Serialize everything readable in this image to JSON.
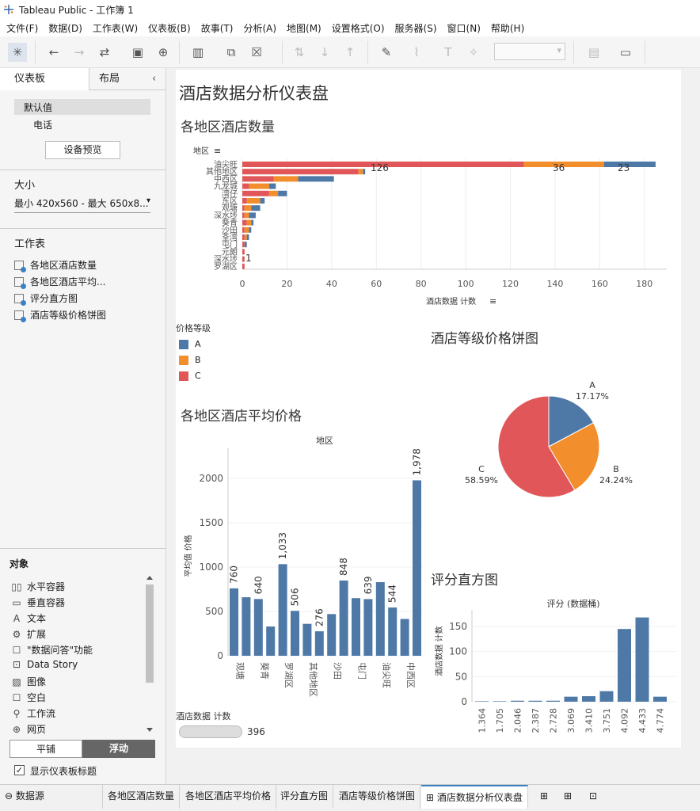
{
  "window": {
    "title": "Tableau Public - 工作簿 1"
  },
  "menu": [
    "文件(F)",
    "数据(D)",
    "工作表(W)",
    "仪表板(B)",
    "故事(T)",
    "分析(A)",
    "地图(M)",
    "设置格式(O)",
    "服务器(S)",
    "窗口(N)",
    "帮助(H)"
  ],
  "toolbar": {
    "icons": [
      "tableau-logo-icon",
      "undo-icon",
      "redo-icon",
      "replay-icon",
      "save-icon",
      "new-datasource-icon",
      "new-worksheet-icon",
      "duplicate-icon",
      "clear-icon",
      "swap-icon",
      "sort-asc-icon",
      "sort-desc-icon",
      "highlight-icon",
      "annotate-icon",
      "labels-icon",
      "pin-icon",
      "show-me-icon",
      "presentation-icon"
    ]
  },
  "left_pane": {
    "tabs": [
      "仪表板",
      "布局"
    ],
    "device_default": "默认值",
    "device_phone": "电话",
    "device_preview_button": "设备预览",
    "size_title": "大小",
    "size_value": "最小 420x560 - 最大 650x8...",
    "worksheets_title": "工作表",
    "worksheets": [
      "各地区酒店数量",
      "各地区酒店平均...",
      "评分直方图",
      "酒店等级价格饼图"
    ],
    "objects_title": "对象",
    "objects": [
      {
        "icon": "horizontal-container-icon",
        "label": "水平容器"
      },
      {
        "icon": "vertical-container-icon",
        "label": "垂直容器"
      },
      {
        "icon": "text-icon",
        "label": "文本"
      },
      {
        "icon": "extension-icon",
        "label": "扩展"
      },
      {
        "icon": "ask-data-icon",
        "label": "\"数据问答\"功能"
      },
      {
        "icon": "data-story-icon",
        "label": "Data Story"
      },
      {
        "icon": "image-icon",
        "label": "图像"
      },
      {
        "icon": "blank-icon",
        "label": "空白"
      },
      {
        "icon": "workflow-icon",
        "label": "工作流"
      },
      {
        "icon": "web-icon",
        "label": "网页"
      }
    ],
    "toggle_tiled": "平铺",
    "toggle_floating": "浮动",
    "show_title_label": "显示仪表板标题",
    "show_title_checked": true
  },
  "dashboard": {
    "title": "酒店数据分析仪表盘",
    "colors": {
      "A": "#4e79a7",
      "B": "#f28e2b",
      "C": "#e15759"
    },
    "legend_title": "价格等级",
    "legend_items": [
      "A",
      "B",
      "C"
    ],
    "count_label": "酒店数据 计数",
    "count_value": "396",
    "sheet_titles": {
      "bar": "各地区酒店数量",
      "avg": "各地区酒店平均价格",
      "pie": "酒店等级价格饼图",
      "hist": "评分直方图"
    }
  },
  "chart_data": [
    {
      "type": "bar",
      "orientation": "horizontal",
      "stacked": true,
      "title": "各地区酒店数量",
      "ylabel": "地区",
      "xlabel": "酒店数据 计数",
      "categories": [
        "油尖旺",
        "其他地区",
        "中西区",
        "九龙城",
        "湾仔",
        "东区",
        "观塘",
        "深水埗",
        "葵青",
        "沙田",
        "荃湾",
        "屯门",
        "元朗",
        "深水埗",
        "罗湖区"
      ],
      "series": [
        {
          "name": "C",
          "values": [
            126,
            52,
            14,
            3,
            12,
            2,
            1,
            1,
            2,
            1,
            1,
            1,
            1,
            1,
            1
          ]
        },
        {
          "name": "B",
          "values": [
            36,
            2,
            11,
            9,
            4,
            6,
            3,
            2,
            2,
            2,
            1,
            0,
            0,
            0,
            0
          ]
        },
        {
          "name": "A",
          "values": [
            23,
            1,
            16,
            3,
            4,
            2,
            4,
            3,
            1,
            1,
            1,
            1,
            0,
            0,
            0
          ]
        }
      ],
      "data_labels": [
        "126",
        "36",
        "23",
        "1"
      ],
      "xticks": [
        0,
        20,
        40,
        60,
        80,
        100,
        120,
        140,
        160,
        180
      ],
      "xlim": [
        0,
        190
      ]
    },
    {
      "type": "bar",
      "title": "各地区酒店平均价格",
      "xlabel": "地区",
      "ylabel": "平均值 价格",
      "categories": [
        "观塘",
        "",
        "葵青",
        "",
        "罗湖区",
        "",
        "其他地区",
        "",
        "沙田",
        "",
        "屯门",
        "",
        "油尖旺",
        "",
        "中西区"
      ],
      "values": [
        760,
        660,
        640,
        330,
        1033,
        506,
        360,
        276,
        470,
        848,
        650,
        639,
        830,
        544,
        415,
        1978
      ],
      "data_labels": [
        "760",
        "640",
        "1,033",
        "506",
        "276",
        "848",
        "639",
        "544",
        "1,978"
      ],
      "yticks": [
        0,
        500,
        1000,
        1500,
        2000
      ],
      "ylim": [
        0,
        2250
      ]
    },
    {
      "type": "pie",
      "title": "酒店等级价格饼图",
      "labels": [
        "A",
        "B",
        "C"
      ],
      "values": [
        17.17,
        24.24,
        58.59
      ],
      "value_labels": [
        "17.17%",
        "24.24%",
        "58.59%"
      ]
    },
    {
      "type": "bar",
      "title": "评分直方图",
      "xlabel": "评分 (数据桶)",
      "ylabel": "酒店数据 计数",
      "categories": [
        "1.364",
        "1.705",
        "2.046",
        "2.387",
        "2.728",
        "3.069",
        "3.410",
        "3.751",
        "4.092",
        "4.433",
        "4.774"
      ],
      "values": [
        1,
        1,
        2,
        2,
        2,
        10,
        11,
        21,
        145,
        168,
        10
      ],
      "yticks": [
        0,
        50,
        100,
        150
      ],
      "ylim": [
        0,
        180
      ]
    }
  ],
  "bottom_tabs": {
    "datasource": "数据源",
    "sheets": [
      "各地区酒店数量",
      "各地区酒店平均价格",
      "评分直方图",
      "酒店等级价格饼图",
      "酒店数据分析仪表盘"
    ],
    "active": "酒店数据分析仪表盘"
  }
}
